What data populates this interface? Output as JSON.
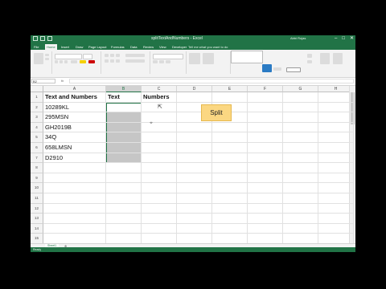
{
  "titlebar": {
    "title": "splitTextAndNumbers - Excel",
    "user": "Abbi Rojas"
  },
  "tabs": [
    "File",
    "Home",
    "Insert",
    "Draw",
    "Page Layout",
    "Formulas",
    "Data",
    "Review",
    "View",
    "Developer"
  ],
  "tell_me": "Tell me what you want to do",
  "formula_bar": {
    "namebox": "B2",
    "fx": "fx",
    "value": ""
  },
  "columns": [
    "A",
    "B",
    "C",
    "D",
    "E",
    "F",
    "G",
    "H"
  ],
  "rows": [
    "1",
    "2",
    "3",
    "4",
    "5",
    "6",
    "7",
    "8",
    "9",
    "10",
    "11",
    "12",
    "13",
    "14",
    "15"
  ],
  "cells": {
    "A1": "Text and Numbers",
    "B1": "Text",
    "C1": "Numbers",
    "A2": "10289KL",
    "A3": "295MSN",
    "A4": "GH2019B",
    "A5": "34Q",
    "A6": "658LMSN",
    "A7": "D2910"
  },
  "split_button": "Split",
  "sheet_tab": "Sheet1",
  "status": "Ready",
  "colors": {
    "excel_green": "#217346",
    "button_fill": "#fbd782",
    "selection": "#c6c6c6"
  }
}
